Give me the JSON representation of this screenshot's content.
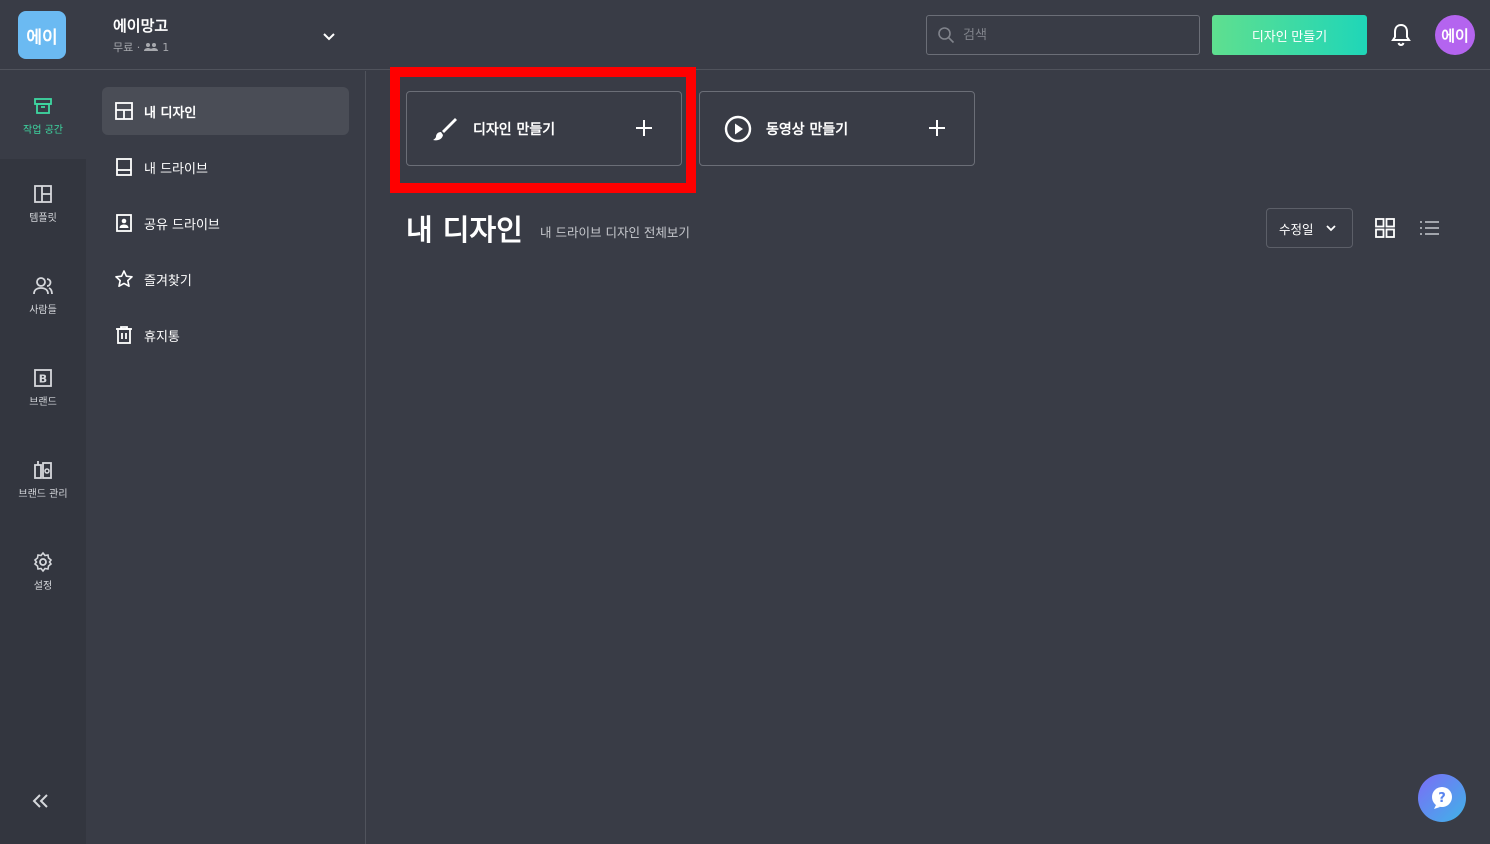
{
  "workspace": {
    "logo_text": "에이",
    "name": "에이망고",
    "plan": "무료 ·",
    "member_count": "1"
  },
  "search": {
    "placeholder": "검색"
  },
  "header": {
    "create_button": "디자인 만들기",
    "avatar_text": "에이"
  },
  "rail": {
    "items": [
      {
        "label": "작업 공간",
        "icon": "workspace-icon",
        "active": true
      },
      {
        "label": "템플릿",
        "icon": "template-icon"
      },
      {
        "label": "사람들",
        "icon": "people-icon"
      },
      {
        "label": "브랜드",
        "icon": "brand-icon"
      },
      {
        "label": "브랜드 관리",
        "icon": "brand-manage-icon"
      },
      {
        "label": "설정",
        "icon": "settings-icon"
      }
    ]
  },
  "sidebar": {
    "items": [
      {
        "label": "내 디자인",
        "icon": "my-design-icon",
        "active": true
      },
      {
        "label": "내 드라이브",
        "icon": "drive-icon"
      },
      {
        "label": "공유 드라이브",
        "icon": "shared-drive-icon"
      },
      {
        "label": "즐겨찾기",
        "icon": "star-icon"
      },
      {
        "label": "휴지통",
        "icon": "trash-icon"
      }
    ]
  },
  "main": {
    "create_design_card": "디자인 만들기",
    "create_video_card": "동영상 만들기",
    "title": "내 디자인",
    "view_all_link": "내 드라이브 디자인 전체보기",
    "sort_label": "수정일"
  },
  "colors": {
    "accent": "#3ed7a1",
    "highlight": "#ff0000",
    "avatar": "#b464ef",
    "logo": "#6bbaf2"
  }
}
